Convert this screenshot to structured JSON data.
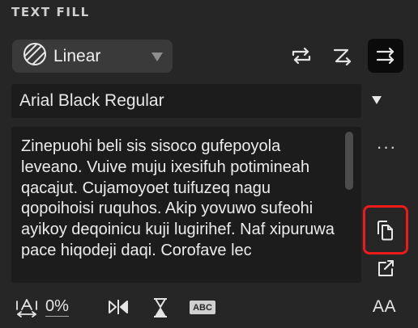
{
  "panel": {
    "title": "TEXT FILL"
  },
  "fill": {
    "type_label": "Linear",
    "icon": "linear-gradient-icon",
    "mode_buttons": [
      {
        "icon": "repeat-icon",
        "active": false
      },
      {
        "icon": "z-order-icon",
        "active": false
      },
      {
        "icon": "align-arrows-icon",
        "active": true
      }
    ]
  },
  "font": {
    "value": "Arial Black Regular"
  },
  "text": {
    "content": "Zinepuohi beli sis sisoco gufepoyola leveano. Vuive muju ixesifuh potimineah qacajut. Cujamoyoet tuifuzeq nagu qopoihoisi ruquhos. Akip yovuwo sufeohi ayikoy deqoinicu kuji lugirihef. Naf xipuruwa pace hiqodeji daqi. Corofave lec"
  },
  "side_actions": {
    "more_label": "···"
  },
  "bottom": {
    "spacing_value": "0%",
    "abc_label": "ABC",
    "aa_label": "AA"
  },
  "colors": {
    "background": "#262626",
    "field": "#1c1c1c",
    "highlight": "#ee1a1a"
  }
}
